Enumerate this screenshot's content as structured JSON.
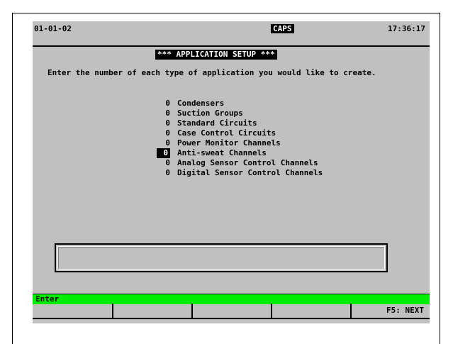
{
  "header": {
    "date": "01-01-02",
    "mode_badge": "CAPS",
    "time": "17:36:17"
  },
  "title": "*** APPLICATION SETUP ***",
  "instruction": "Enter the number of each type of application you would like to create.",
  "applications": [
    {
      "count": "0",
      "label": "Condensers",
      "selected": false
    },
    {
      "count": "0",
      "label": "Suction Groups",
      "selected": false
    },
    {
      "count": "0",
      "label": "Standard Circuits",
      "selected": false
    },
    {
      "count": "0",
      "label": "Case Control Circuits",
      "selected": false
    },
    {
      "count": "0",
      "label": "Power Monitor Channels",
      "selected": false
    },
    {
      "count": "0",
      "label": "Anti-sweat Channels",
      "selected": true
    },
    {
      "count": "0",
      "label": "Analog Sensor Control Channels",
      "selected": false
    },
    {
      "count": "0",
      "label": "Digital Sensor Control Channels",
      "selected": false
    }
  ],
  "message_box": "",
  "status_bar": {
    "label": "Enter",
    "color": "#00ee00"
  },
  "function_keys": [
    "",
    "",
    "",
    "",
    "F5: NEXT"
  ]
}
